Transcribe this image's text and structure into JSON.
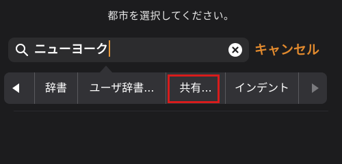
{
  "prompt": "都市を選択してください。",
  "search": {
    "value": "ニューヨーク",
    "clear_icon": "clear-icon",
    "icon": "search-icon"
  },
  "cancel_label": "キャンセル",
  "menu": {
    "prev_icon": "chevron-left-icon",
    "next_icon": "chevron-right-icon",
    "items": [
      {
        "label": "辞書"
      },
      {
        "label": "ユーザ辞書..."
      },
      {
        "label": "共有..."
      },
      {
        "label": "インデント"
      }
    ]
  },
  "colors": {
    "background": "#1c1c1e",
    "accent": "#e28a2e",
    "highlight": "#d81c1c"
  }
}
